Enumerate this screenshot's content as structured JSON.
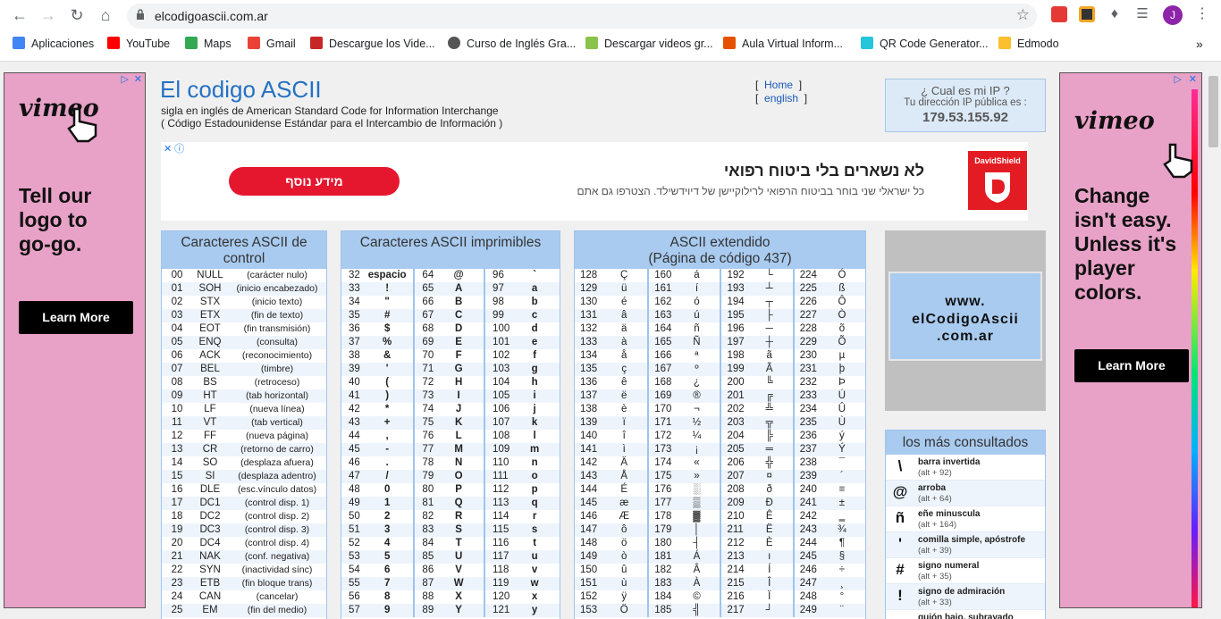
{
  "browser": {
    "url": "elcodigoascii.com.ar",
    "profile_initial": "J"
  },
  "bookmarks": [
    {
      "label": "Aplicaciones",
      "color": "#4285f4"
    },
    {
      "label": "YouTube",
      "color": "#ff0000"
    },
    {
      "label": "Maps",
      "color": "#34a853"
    },
    {
      "label": "Gmail",
      "color": "#ea4335"
    },
    {
      "label": "Descargue los Vide...",
      "color": "#c62828"
    },
    {
      "label": "Curso de Inglés Gra...",
      "color": "#555555"
    },
    {
      "label": "Descargar videos gr...",
      "color": "#8bc34a"
    },
    {
      "label": "Aula Virtual Inform...",
      "color": "#e65100"
    },
    {
      "label": "QR Code Generator...",
      "color": "#26c6da"
    },
    {
      "label": "Edmodo",
      "color": "#fbc02d"
    }
  ],
  "left_ad": {
    "logo": "vimeo",
    "tagline": "Tell our logo to go-go.",
    "button": "Learn More"
  },
  "right_ad": {
    "logo": "vimeo",
    "tagline": "Change isn't easy. Unless it's player colors.",
    "button": "Learn More"
  },
  "header": {
    "title": "El codigo ASCII",
    "subtitle1": "sigla en inglés de American Standard Code for Information Interchange",
    "subtitle2": "( Código Estadounidense Estándar para el Intercambio de Información )",
    "nav_home": "Home",
    "nav_english": "english"
  },
  "ip_box": {
    "title": "¿ Cual es mi IP ?",
    "label": "Tu dirección IP pública es :",
    "ip": "179.53.155.92"
  },
  "mid_ad": {
    "headline": "לא נשארים בלי ביטוח רפואי",
    "text": "כל ישראלי שני בוחר בביטוח הרפואי לרילוקיישן של דיוידשילד. הצטרפו גם אתם",
    "button": "מידע נוסף",
    "logo": "DavidShield"
  },
  "control_table": {
    "title": "Caracteres ASCII de control",
    "rows": [
      [
        "00",
        "NULL",
        "(carácter nulo)"
      ],
      [
        "01",
        "SOH",
        "(inicio encabezado)"
      ],
      [
        "02",
        "STX",
        "(inicio texto)"
      ],
      [
        "03",
        "ETX",
        "(fin de texto)"
      ],
      [
        "04",
        "EOT",
        "(fin transmisión)"
      ],
      [
        "05",
        "ENQ",
        "(consulta)"
      ],
      [
        "06",
        "ACK",
        "(reconocimiento)"
      ],
      [
        "07",
        "BEL",
        "(timbre)"
      ],
      [
        "08",
        "BS",
        "(retroceso)"
      ],
      [
        "09",
        "HT",
        "(tab horizontal)"
      ],
      [
        "10",
        "LF",
        "(nueva línea)"
      ],
      [
        "11",
        "VT",
        "(tab vertical)"
      ],
      [
        "12",
        "FF",
        "(nueva página)"
      ],
      [
        "13",
        "CR",
        "(retorno de carro)"
      ],
      [
        "14",
        "SO",
        "(desplaza afuera)"
      ],
      [
        "15",
        "SI",
        "(desplaza adentro)"
      ],
      [
        "16",
        "DLE",
        "(esc.vínculo datos)"
      ],
      [
        "17",
        "DC1",
        "(control disp. 1)"
      ],
      [
        "18",
        "DC2",
        "(control disp. 2)"
      ],
      [
        "19",
        "DC3",
        "(control disp. 3)"
      ],
      [
        "20",
        "DC4",
        "(control disp. 4)"
      ],
      [
        "21",
        "NAK",
        "(conf. negativa)"
      ],
      [
        "22",
        "SYN",
        "(inactividad sínc)"
      ],
      [
        "23",
        "ETB",
        "(fin bloque trans)"
      ],
      [
        "24",
        "CAN",
        "(cancelar)"
      ],
      [
        "25",
        "EM",
        "(fin del medio)"
      ]
    ]
  },
  "printable_table": {
    "title": "Caracteres ASCII imprimibles",
    "rows": [
      [
        "32",
        "espacio",
        "64",
        "@",
        "96",
        "`"
      ],
      [
        "33",
        "!",
        "65",
        "A",
        "97",
        "a"
      ],
      [
        "34",
        "\"",
        "66",
        "B",
        "98",
        "b"
      ],
      [
        "35",
        "#",
        "67",
        "C",
        "99",
        "c"
      ],
      [
        "36",
        "$",
        "68",
        "D",
        "100",
        "d"
      ],
      [
        "37",
        "%",
        "69",
        "E",
        "101",
        "e"
      ],
      [
        "38",
        "&",
        "70",
        "F",
        "102",
        "f"
      ],
      [
        "39",
        "'",
        "71",
        "G",
        "103",
        "g"
      ],
      [
        "40",
        "(",
        "72",
        "H",
        "104",
        "h"
      ],
      [
        "41",
        ")",
        "73",
        "I",
        "105",
        "i"
      ],
      [
        "42",
        "*",
        "74",
        "J",
        "106",
        "j"
      ],
      [
        "43",
        "+",
        "75",
        "K",
        "107",
        "k"
      ],
      [
        "44",
        ",",
        "76",
        "L",
        "108",
        "l"
      ],
      [
        "45",
        "-",
        "77",
        "M",
        "109",
        "m"
      ],
      [
        "46",
        ".",
        "78",
        "N",
        "110",
        "n"
      ],
      [
        "47",
        "/",
        "79",
        "O",
        "111",
        "o"
      ],
      [
        "48",
        "0",
        "80",
        "P",
        "112",
        "p"
      ],
      [
        "49",
        "1",
        "81",
        "Q",
        "113",
        "q"
      ],
      [
        "50",
        "2",
        "82",
        "R",
        "114",
        "r"
      ],
      [
        "51",
        "3",
        "83",
        "S",
        "115",
        "s"
      ],
      [
        "52",
        "4",
        "84",
        "T",
        "116",
        "t"
      ],
      [
        "53",
        "5",
        "85",
        "U",
        "117",
        "u"
      ],
      [
        "54",
        "6",
        "86",
        "V",
        "118",
        "v"
      ],
      [
        "55",
        "7",
        "87",
        "W",
        "119",
        "w"
      ],
      [
        "56",
        "8",
        "88",
        "X",
        "120",
        "x"
      ],
      [
        "57",
        "9",
        "89",
        "Y",
        "121",
        "y"
      ]
    ]
  },
  "extended_table": {
    "title": "ASCII extendido",
    "subtitle": "(Página de código 437)",
    "rows": [
      [
        "128",
        "Ç",
        "160",
        "á",
        "192",
        "└",
        "224",
        "Ó"
      ],
      [
        "129",
        "ü",
        "161",
        "í",
        "193",
        "┴",
        "225",
        "ß"
      ],
      [
        "130",
        "é",
        "162",
        "ó",
        "194",
        "┬",
        "226",
        "Ô"
      ],
      [
        "131",
        "â",
        "163",
        "ú",
        "195",
        "├",
        "227",
        "Ò"
      ],
      [
        "132",
        "ä",
        "164",
        "ñ",
        "196",
        "─",
        "228",
        "õ"
      ],
      [
        "133",
        "à",
        "165",
        "Ñ",
        "197",
        "┼",
        "229",
        "Õ"
      ],
      [
        "134",
        "å",
        "166",
        "ª",
        "198",
        "ã",
        "230",
        "µ"
      ],
      [
        "135",
        "ç",
        "167",
        "º",
        "199",
        "Ã",
        "231",
        "þ"
      ],
      [
        "136",
        "ê",
        "168",
        "¿",
        "200",
        "╚",
        "232",
        "Þ"
      ],
      [
        "137",
        "ë",
        "169",
        "®",
        "201",
        "╔",
        "233",
        "Ú"
      ],
      [
        "138",
        "è",
        "170",
        "¬",
        "202",
        "╩",
        "234",
        "Û"
      ],
      [
        "139",
        "ï",
        "171",
        "½",
        "203",
        "╦",
        "235",
        "Ù"
      ],
      [
        "140",
        "î",
        "172",
        "¼",
        "204",
        "╠",
        "236",
        "ý"
      ],
      [
        "141",
        "ì",
        "173",
        "¡",
        "205",
        "═",
        "237",
        "Ý"
      ],
      [
        "142",
        "Ä",
        "174",
        "«",
        "206",
        "╬",
        "238",
        "¯"
      ],
      [
        "143",
        "Å",
        "175",
        "»",
        "207",
        "¤",
        "239",
        "´"
      ],
      [
        "144",
        "É",
        "176",
        "░",
        "208",
        "ð",
        "240",
        "≡"
      ],
      [
        "145",
        "æ",
        "177",
        "▒",
        "209",
        "Ð",
        "241",
        "±"
      ],
      [
        "146",
        "Æ",
        "178",
        "▓",
        "210",
        "Ê",
        "242",
        "‗"
      ],
      [
        "147",
        "ô",
        "179",
        "│",
        "211",
        "Ë",
        "243",
        "¾"
      ],
      [
        "148",
        "ö",
        "180",
        "┤",
        "212",
        "È",
        "244",
        "¶"
      ],
      [
        "149",
        "ò",
        "181",
        "Á",
        "213",
        "ı",
        "245",
        "§"
      ],
      [
        "150",
        "û",
        "182",
        "Â",
        "214",
        "Í",
        "246",
        "÷"
      ],
      [
        "151",
        "ù",
        "183",
        "À",
        "215",
        "Î",
        "247",
        "¸"
      ],
      [
        "152",
        "ÿ",
        "184",
        "©",
        "216",
        "Ï",
        "248",
        "°"
      ],
      [
        "153",
        "Ö",
        "185",
        "╣",
        "217",
        "┘",
        "249",
        "¨"
      ]
    ]
  },
  "www_box": "www. elCodigoAscii .com.ar",
  "consultados": {
    "title": "los más consultados",
    "items": [
      {
        "sym": "\\",
        "name": "barra invertida",
        "alt": "(alt + 92)"
      },
      {
        "sym": "@",
        "name": "arroba",
        "alt": "(alt + 64)"
      },
      {
        "sym": "ñ",
        "name": "eñe minuscula",
        "alt": "(alt + 164)"
      },
      {
        "sym": "'",
        "name": "comilla simple, apóstrofe",
        "alt": "(alt + 39)"
      },
      {
        "sym": "#",
        "name": "signo numeral",
        "alt": "(alt + 35)"
      },
      {
        "sym": "!",
        "name": "signo de admiración",
        "alt": "(alt + 33)"
      },
      {
        "sym": "_",
        "name": "guión bajo, subrayado",
        "alt": ""
      }
    ]
  }
}
